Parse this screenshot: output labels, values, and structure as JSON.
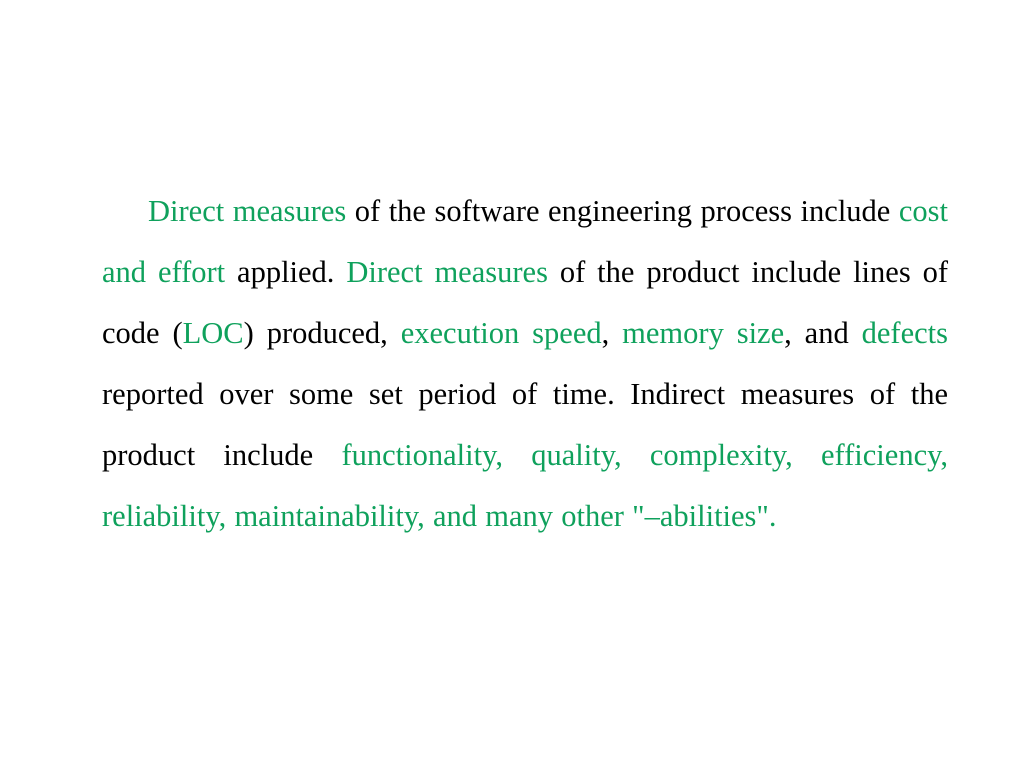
{
  "slide": {
    "background_color": "#ffffff",
    "text_color": "#000000",
    "highlight_color": "#0fa15c",
    "paragraph_runs": [
      {
        "text": "Direct measures",
        "style": "highlight"
      },
      {
        "text": " of the software engineering process include ",
        "style": "normal"
      },
      {
        "text": "cost and effort",
        "style": "highlight"
      },
      {
        "text": " applied. ",
        "style": "normal"
      },
      {
        "text": "Direct measures",
        "style": "highlight"
      },
      {
        "text": " of the product include lines of code (",
        "style": "normal"
      },
      {
        "text": "LOC",
        "style": "highlight"
      },
      {
        "text": ") produced, ",
        "style": "normal"
      },
      {
        "text": "execution speed",
        "style": "highlight"
      },
      {
        "text": ", ",
        "style": "normal"
      },
      {
        "text": "memory size",
        "style": "highlight"
      },
      {
        "text": ", and ",
        "style": "normal"
      },
      {
        "text": "defects",
        "style": "highlight"
      },
      {
        "text": " reported over some set period of time. Indirect measures of the product include ",
        "style": "normal"
      },
      {
        "text": "functionality, quality, complexity, efficiency, reliability, maintainability, and many other \"–abilities\".",
        "style": "highlight"
      }
    ],
    "full_text": "Direct measures of the software engineering process include cost and effort applied. Direct measures of the product include lines of code (LOC) produced, execution speed, memory size, and defects reported over some set period of time. Indirect measures of the product include functionality, quality, complexity, efficiency, reliability, maintainability, and many other \"–abilities\".",
    "run_0": "Direct measures",
    "run_1": " of the software engineering process include ",
    "run_2": "cost and effort",
    "run_3": " applied. ",
    "run_4": "Direct measures",
    "run_5": " of the product include lines of code (",
    "run_6": "LOC",
    "run_7": ") produced, ",
    "run_8": "execution speed",
    "run_9": ", ",
    "run_10": "memory size",
    "run_11": ", and ",
    "run_12": "defects",
    "run_13": " reported over some set period of time. Indirect measures of the product include ",
    "run_14": "functionality, quality, complexity, efficiency, reliability, maintainability, and many other \"–abilities\"."
  }
}
